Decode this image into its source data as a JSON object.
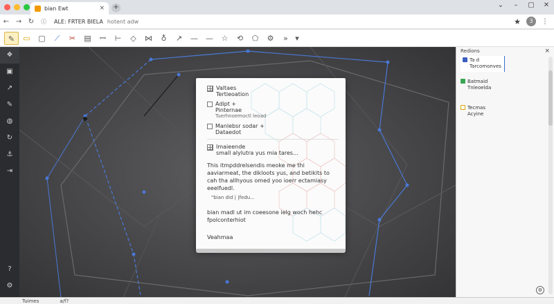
{
  "browser": {
    "tab_title": "bian Ewt",
    "new_tab": "+",
    "tab_close": "×",
    "url": "ALE: FRTER BIELA",
    "url_suffix": "hotent adw",
    "avatar_initial": "3"
  },
  "sidebar_panel": {
    "header": "Redions",
    "close": "×",
    "items": [
      {
        "line1": "Ta d",
        "line2": "Tarcomonves",
        "color": "#3b5fc0"
      },
      {
        "line1": "Batmaid",
        "line2": "Tnleoelda",
        "color": "#3aa655"
      },
      {
        "line1": "Tecmas",
        "line2": "Acyine",
        "color": "#d9a300"
      }
    ]
  },
  "dialog": {
    "options": [
      {
        "label": "Valtaes",
        "sub": "Tertieoation",
        "icon": "grid"
      },
      {
        "label": "Adipt +",
        "label2": "Pinternae",
        "sub": "Tuerhnoemoctl leoad",
        "icon": "checkbox"
      },
      {
        "label": "Manlebsr sodar +",
        "label2": "Dataedot",
        "icon": "checkbox"
      }
    ],
    "section_title": "Imaieende",
    "section_sub": "small alylutra yus mia tares...",
    "paragraph": "This itmpddrelsendis meoke me thi aaviarmeat, the dikloots yus, and betikits to cah tha allhyous omed yoo ioerr ectamiasy eeelfuedl.",
    "code_line": "\"bian did | |fedu...",
    "footer_para": "bian madl ut im coeesone ielg woch hehc fpolconterhiot",
    "signature": "Veahmaa"
  },
  "statusbar": {
    "left": "Tuimes",
    "right": "a/f?"
  },
  "colors": {
    "accent": "#3a6fd0",
    "canvas": "#4a4a4c",
    "rail": "#2b2c2f"
  },
  "icons": {
    "toolbar": [
      "select-icon",
      "folder-icon",
      "comment-icon",
      "pen-icon",
      "eraser-icon",
      "document-icon",
      "text-icon",
      "split-icon",
      "shape-icon",
      "node-icon",
      "pointer-icon",
      "line-icon",
      "dash-icon",
      "star-icon",
      "lasso-icon",
      "image-icon",
      "settings-icon",
      "arrow-icon"
    ],
    "rail": [
      "layers-icon",
      "page-icon",
      "pin-icon",
      "brush-icon",
      "globe-icon",
      "refresh-icon",
      "anchor-icon",
      "dimension-icon"
    ]
  }
}
